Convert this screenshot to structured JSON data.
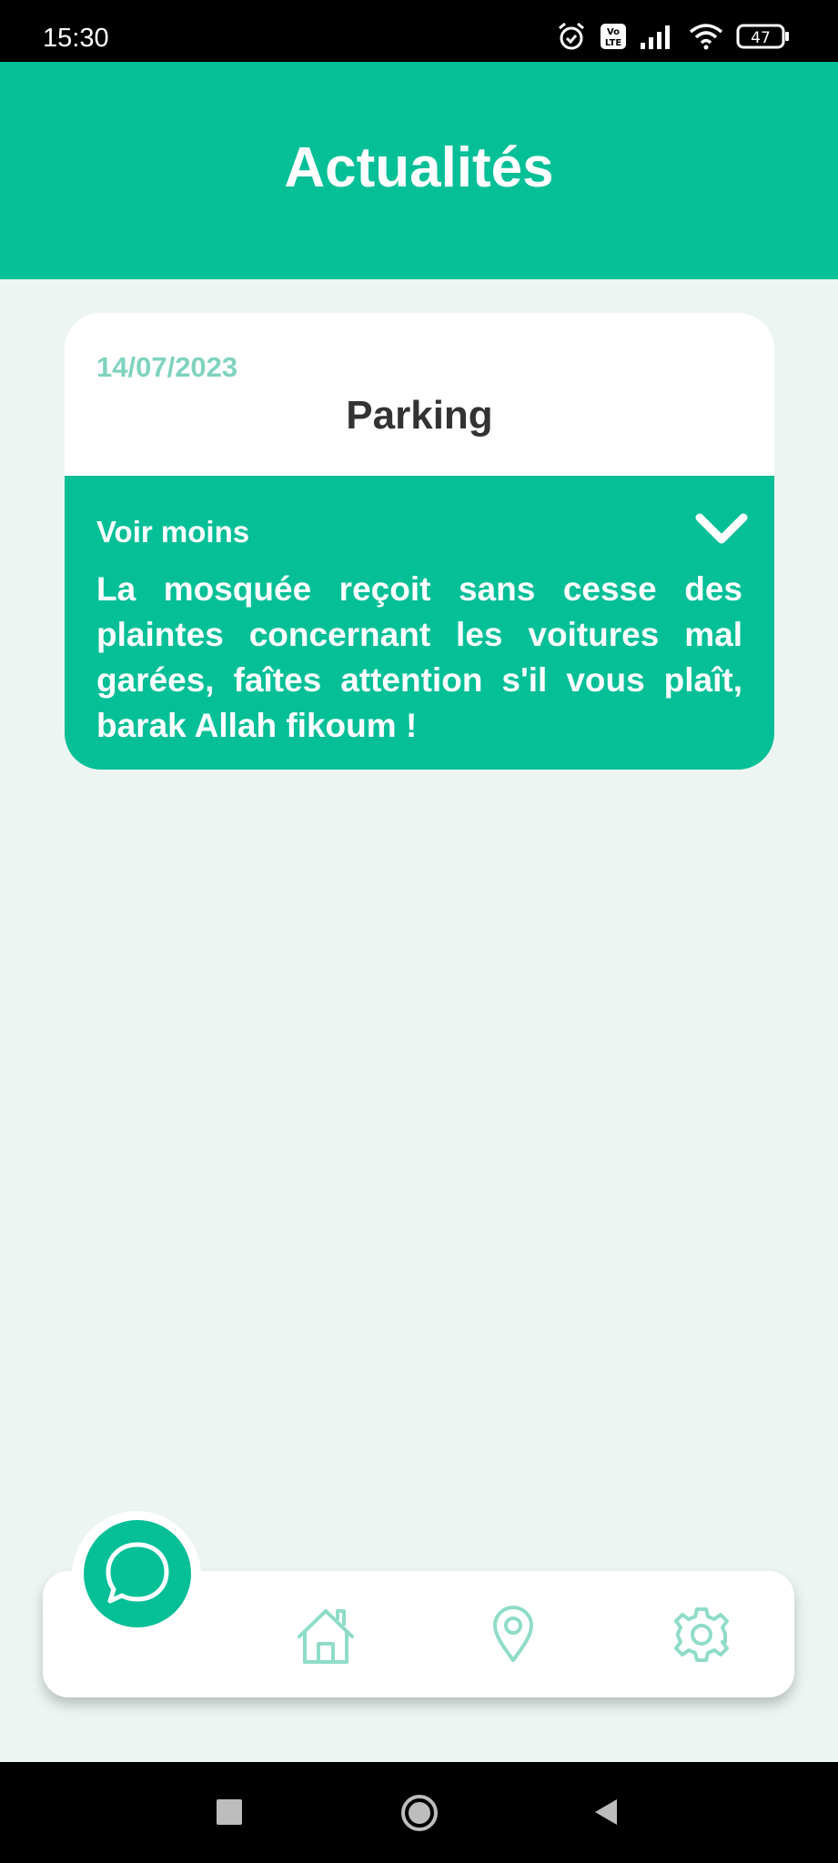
{
  "status_bar": {
    "time": "15:30",
    "battery": "47",
    "icons": [
      "alarm-icon",
      "volte-icon",
      "signal-icon",
      "wifi-icon",
      "battery-icon"
    ]
  },
  "header": {
    "title": "Actualités"
  },
  "news_card": {
    "date": "14/07/2023",
    "title": "Parking",
    "toggle_label": "Voir moins",
    "body": "La mosquée reçoit sans cesse des plaintes concernant les voitures mal garées, faîtes attention s'il vous plaît, barak Allah fikoum !",
    "expanded_icon": "chevron-down-icon"
  },
  "bottom_nav": {
    "items": [
      "chat-icon",
      "home-icon",
      "location-pin-icon",
      "settings-gear-icon"
    ]
  },
  "system_nav": {
    "items": [
      "recents-square-icon",
      "home-circle-icon",
      "back-triangle-icon"
    ]
  },
  "colors": {
    "primary": "#05bf97",
    "background": "#ecf5f2",
    "date_text": "#7fd3bf",
    "nav_icon": "#8fdcc8",
    "title_text": "#333333"
  }
}
